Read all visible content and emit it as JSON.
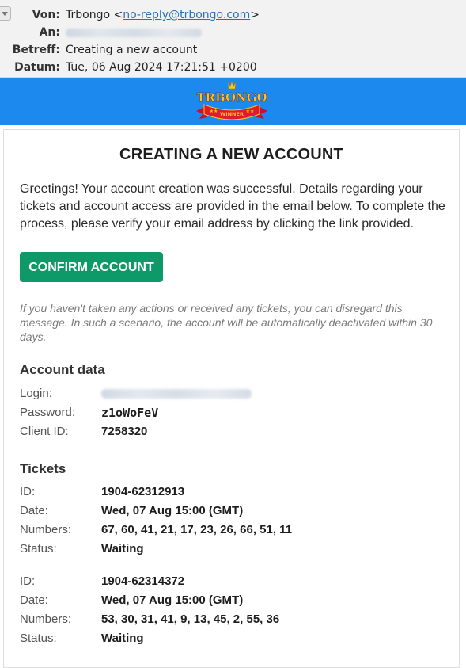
{
  "mail": {
    "from_label": "Von:",
    "from_name": "Trbongo",
    "from_open": "<",
    "from_email": "no-reply@trbongo.com",
    "from_close": ">",
    "to_label": "An:",
    "subject_label": "Betreff:",
    "subject": "Creating a new account",
    "date_label": "Datum:",
    "date": "Tue, 06 Aug 2024 17:21:51 +0200"
  },
  "banner": {
    "logo_text": "TRBONGO",
    "logo_ribbon": "WINNER",
    "brand_color": "#1c89ee"
  },
  "content": {
    "title": "CREATING A NEW ACCOUNT",
    "intro": "Greetings! Your account creation was successful. Details regarding your tickets and account access are provided in the email below. To complete the process, please verify your email address by clicking the link provided.",
    "confirm_button": "CONFIRM ACCOUNT",
    "confirm_color": "#0e9a68",
    "disclaimer": "If you haven't taken any actions or received any tickets, you can disregard this message. In such a scenario, the account will be automatically deactivated within 30 days."
  },
  "account": {
    "heading": "Account data",
    "login_label": "Login:",
    "password_label": "Password:",
    "password": "z1oWoFeV",
    "client_id_label": "Client ID:",
    "client_id": "7258320"
  },
  "tickets": {
    "heading": "Tickets",
    "id_label": "ID:",
    "date_label": "Date:",
    "numbers_label": "Numbers:",
    "status_label": "Status:",
    "items": [
      {
        "id": "1904-62312913",
        "date": "Wed, 07 Aug 15:00 (GMT)",
        "numbers": "67, 60, 41, 21, 17, 23, 26, 66, 51, 11",
        "status": "Waiting"
      },
      {
        "id": "1904-62314372",
        "date": "Wed, 07 Aug 15:00 (GMT)",
        "numbers": "53, 30, 31, 41, 9, 13, 45, 2, 55, 36",
        "status": "Waiting"
      }
    ]
  }
}
